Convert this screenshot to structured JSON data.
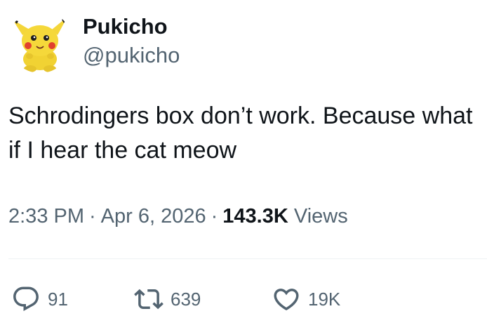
{
  "author": {
    "display_name": "Pukicho",
    "handle": "@pukicho",
    "avatar_icon": "pikachu-plush-avatar"
  },
  "tweet": {
    "text": "Schrodingers box don’t work. Because what if I hear the cat meow"
  },
  "meta": {
    "time": "2:33 PM",
    "date": "Apr 6, 2026",
    "separator": "·",
    "views_count": "143.3K",
    "views_label": "Views"
  },
  "actions": {
    "replies": "91",
    "retweets": "639",
    "likes": "19K"
  },
  "colors": {
    "text_primary": "#0f1419",
    "text_secondary": "#536471",
    "divider": "#eff3f4",
    "avatar_yellow": "#f5d83a"
  }
}
